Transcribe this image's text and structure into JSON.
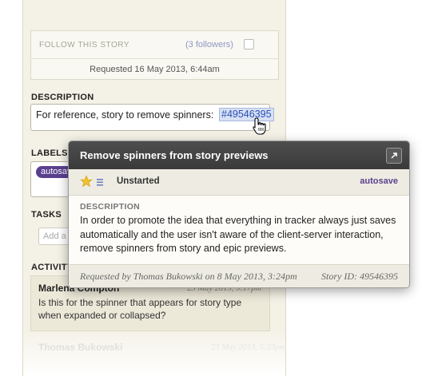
{
  "panel": {
    "follow": {
      "label": "FOLLOW THIS STORY",
      "followers": "(3 followers)"
    },
    "requested": "Requested 16 May 2013, 6:44am",
    "description": {
      "title": "DESCRIPTION",
      "text": "For reference, story to remove spinners:",
      "link": "#49546395"
    },
    "labels": {
      "title": "LABELS",
      "chip": "autosave"
    },
    "tasks": {
      "title": "TASKS",
      "placeholder": "Add a task"
    },
    "activity": {
      "title": "ACTIVITY",
      "items": [
        {
          "author": "Marlena Compton",
          "date": "23 May 2013, 5:17pm",
          "text": "Is this for the spinner that appears for story type when expanded or collapsed?"
        },
        {
          "author": "Thomas Bukowski",
          "date": "23 May 2013, 5:23pm"
        }
      ]
    }
  },
  "popover": {
    "title": "Remove spinners from story previews",
    "state": "Unstarted",
    "label": "autosave",
    "description_title": "DESCRIPTION",
    "description": "In order to promote the idea that everything in tracker always just saves automatically and the user isn't aware of the client-server interaction, remove spinners from story and epic previews.",
    "requested_by": "Requested by Thomas Bukowski on 8 May 2013, 3:24pm",
    "story_id": "Story ID: 49546395"
  },
  "icons": {
    "star": "star-icon",
    "estimate": "estimate-bars-icon",
    "expand": "expand-arrow-icon",
    "cursor": "hand-pointer-icon"
  },
  "colors": {
    "panel_bg": "#f4f1e6",
    "header_bg": "#444444",
    "label_purple": "#5a3f8f",
    "link_blue": "#2a4fb5",
    "star_yellow": "#f2c12e"
  }
}
